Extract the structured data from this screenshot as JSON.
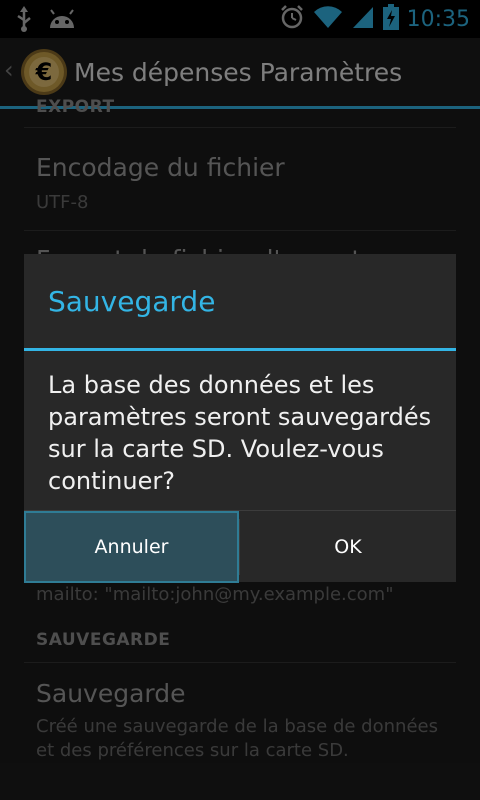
{
  "status_bar": {
    "time": "10:35",
    "icons": [
      "usb-icon",
      "android-debug-icon",
      "alarm-icon",
      "wifi-icon",
      "signal-icon",
      "battery-charging-icon"
    ]
  },
  "action_bar": {
    "title": "Mes dépenses Paramètres",
    "logo_glyph": "€"
  },
  "settings": {
    "export_category": "EXPORT",
    "encoding_title": "Encodage du fichier",
    "encoding_summary": "UTF-8",
    "export_format_title": "Format du fichier d'export",
    "mailto_summary": "mailto: \"mailto:john@my.example.com\"",
    "backup_category": "SAUVEGARDE",
    "backup_title": "Sauvegarde",
    "backup_summary": "Créé une sauvegarde de la base de données et des préférences sur la carte SD."
  },
  "dialog": {
    "title": "Sauvegarde",
    "message": "La base des données et les paramètres seront sauvegardés sur la carte SD. Voulez-vous continuer?",
    "cancel_label": "Annuler",
    "ok_label": "OK"
  },
  "colors": {
    "accent": "#33b5e5"
  }
}
